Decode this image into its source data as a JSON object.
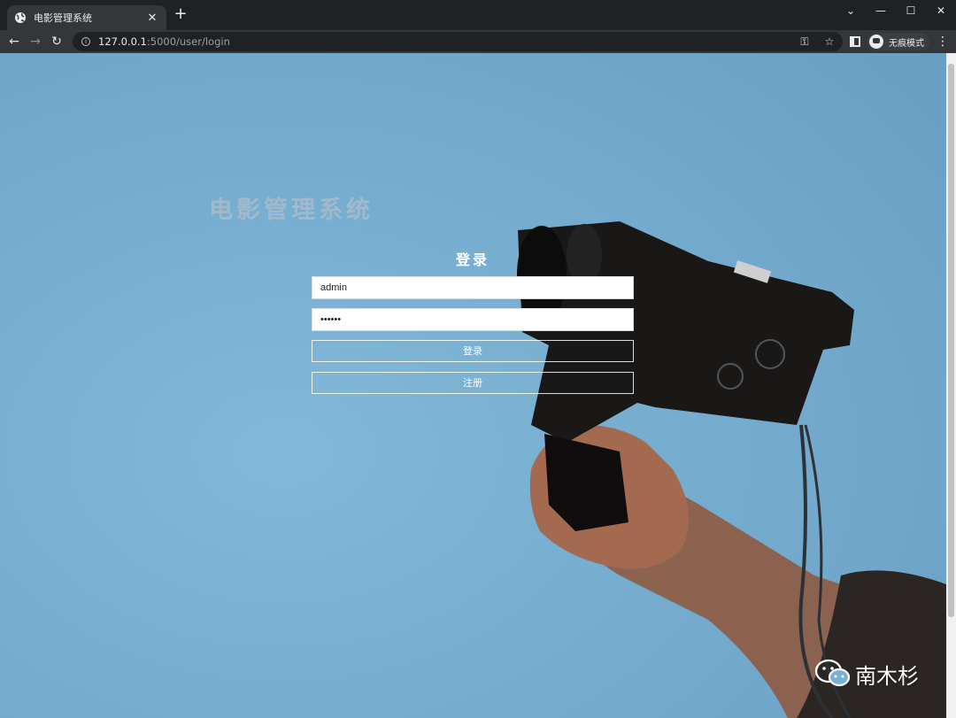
{
  "browser": {
    "tab_title": "电影管理系统",
    "url_host": "127.0.0.1",
    "url_path": ":5000/user/login",
    "incognito_label": "无痕模式",
    "icons": [
      "globe-icon",
      "close-icon",
      "plus-icon",
      "chevron-down-icon",
      "minimize-icon",
      "maximize-icon",
      "close-window-icon",
      "back-icon",
      "forward-icon",
      "reload-icon",
      "info-icon",
      "key-icon",
      "star-icon",
      "sidepanel-icon",
      "incognito-icon",
      "menu-icon"
    ]
  },
  "page": {
    "site_title": "电影管理系统",
    "login_heading": "登录",
    "username": {
      "value": "admin"
    },
    "password": {
      "value": "••••••"
    },
    "login_button": "登录",
    "register_button": "注册",
    "watermark": "南木杉",
    "background_color": "#78b0d2"
  }
}
